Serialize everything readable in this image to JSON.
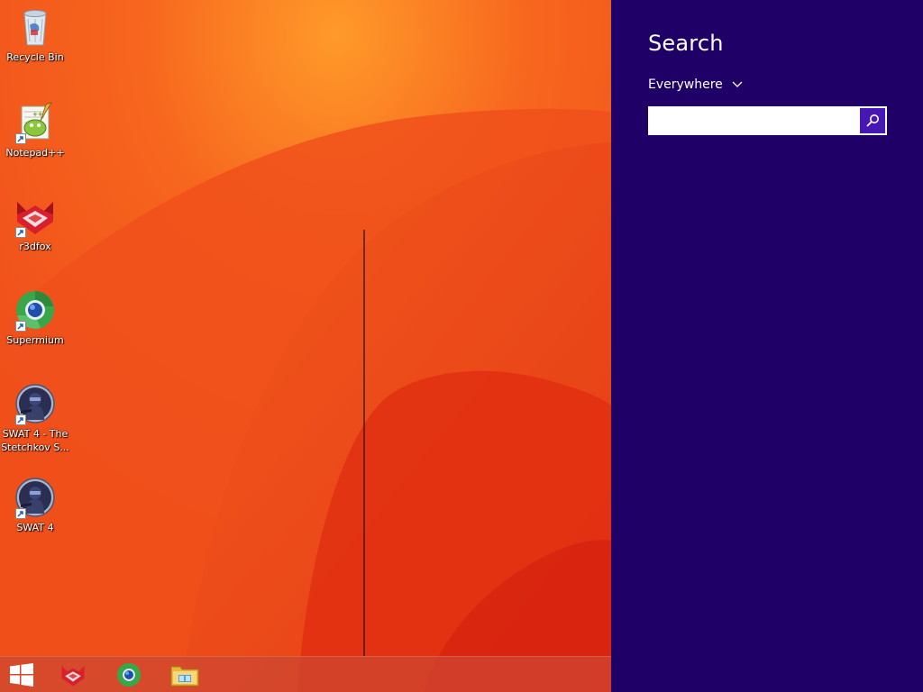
{
  "desktop": {
    "icons": [
      {
        "label": "Recycle Bin",
        "icon": "recycle-bin-icon",
        "shortcut": false
      },
      {
        "label": "Notepad++",
        "icon": "notepad-plus-plus-icon",
        "shortcut": true
      },
      {
        "label": "r3dfox",
        "icon": "r3dfox-icon",
        "shortcut": true
      },
      {
        "label": "Supermium",
        "icon": "supermium-icon",
        "shortcut": true
      },
      {
        "label": "SWAT 4 - The Stetchkov S...",
        "icon": "swat4-icon",
        "shortcut": true
      },
      {
        "label": "SWAT 4",
        "icon": "swat4-icon",
        "shortcut": true
      }
    ]
  },
  "taskbar": {
    "items": [
      {
        "name": "start-button",
        "icon": "windows-logo-icon"
      },
      {
        "name": "taskbar-r3dfox",
        "icon": "r3dfox-icon"
      },
      {
        "name": "taskbar-supermium",
        "icon": "supermium-icon"
      },
      {
        "name": "taskbar-file-explorer",
        "icon": "file-explorer-icon"
      }
    ]
  },
  "charm": {
    "title": "Search",
    "scope_label": "Everywhere",
    "scope_icon": "chevron-down-icon",
    "search_value": "",
    "search_placeholder": "",
    "search_button_icon": "search-icon"
  },
  "colors": {
    "wallpaper": "#f2541c",
    "charm_background": "#1e0067",
    "search_button": "#4617b4"
  }
}
